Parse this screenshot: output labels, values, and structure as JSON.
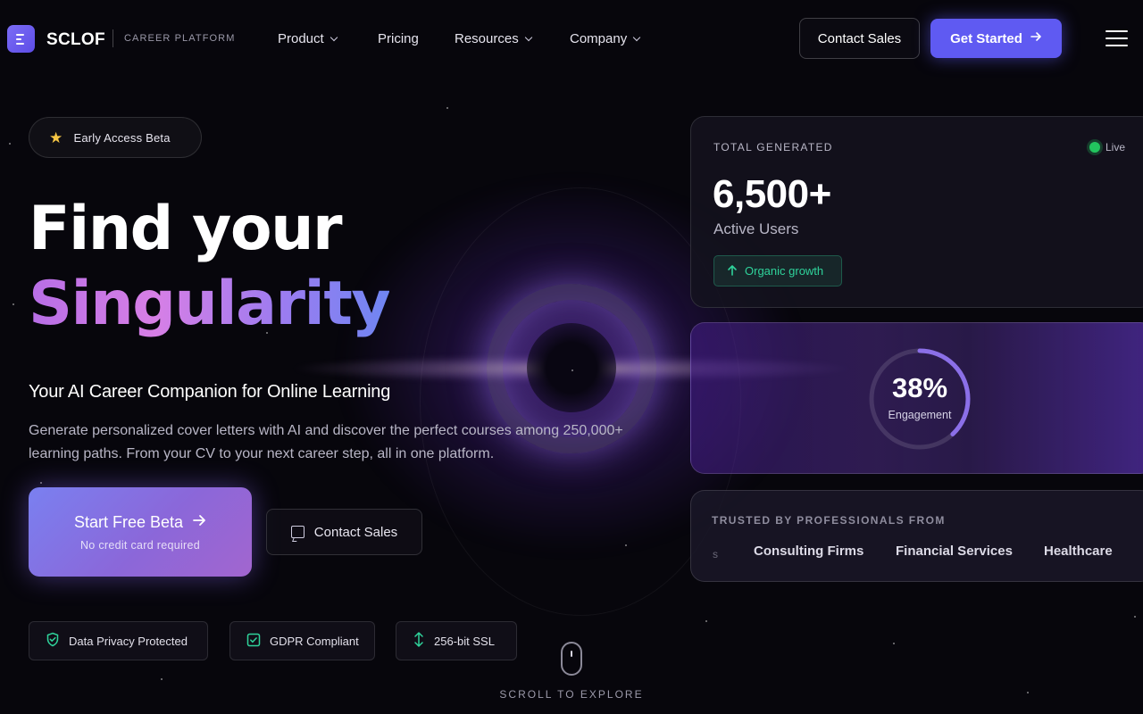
{
  "brand": {
    "name": "SCLOF",
    "tagline": "CAREER PLATFORM"
  },
  "nav": {
    "items": [
      {
        "label": "Product",
        "dropdown": true
      },
      {
        "label": "Pricing",
        "dropdown": false
      },
      {
        "label": "Resources",
        "dropdown": true
      },
      {
        "label": "Company",
        "dropdown": true
      }
    ],
    "contact_label": "Contact Sales",
    "cta_label": "Get Started"
  },
  "hero": {
    "badge_label": "Early Access Beta",
    "title_line1": "Find your",
    "title_line2": "Singularity",
    "subtitle": "Your AI Career Companion for Online Learning",
    "description": "Generate personalized cover letters with AI and discover the perfect courses among 250,000+ learning paths. From your CV to your next career step, all in one platform.",
    "primary_cta": "Start Free Beta",
    "primary_cta_note": "No credit card required",
    "secondary_cta": "Contact Sales",
    "trust_badges": [
      {
        "label": "Data Privacy Protected",
        "icon": "shield-check-icon"
      },
      {
        "label": "GDPR Compliant",
        "icon": "checkbox-icon"
      },
      {
        "label": "256-bit SSL",
        "icon": "lock-icon"
      }
    ],
    "scroll_label": "SCROLL TO EXPLORE"
  },
  "stats": {
    "label": "TOTAL GENERATED",
    "live_label": "Live",
    "value": "6,500+",
    "value_caption": "Active Users",
    "growth_label": "Organic growth"
  },
  "engagement": {
    "percent_text": "38%",
    "percent_value": 38,
    "label": "Engagement"
  },
  "trusted": {
    "label": "TRUSTED BY PROFESSIONALS FROM",
    "companies": [
      "Consulting Firms",
      "Financial Services",
      "Healthcare"
    ]
  },
  "colors": {
    "accent": "#5f5af2",
    "success": "#2fd39b",
    "live": "#22c55e",
    "background": "#07060c"
  }
}
